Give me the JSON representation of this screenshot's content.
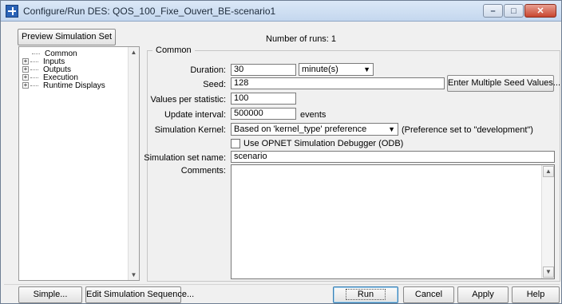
{
  "window": {
    "title": "Configure/Run DES: QOS_100_Fixe_Ouvert_BE-scenario1"
  },
  "top": {
    "preview_label": "Preview Simulation Set",
    "runs_text": "Number of runs: 1"
  },
  "tree": {
    "items": [
      {
        "label": "Common",
        "expandable": false
      },
      {
        "label": "Inputs",
        "expandable": true
      },
      {
        "label": "Outputs",
        "expandable": true
      },
      {
        "label": "Execution",
        "expandable": true
      },
      {
        "label": "Runtime Displays",
        "expandable": true
      }
    ]
  },
  "common": {
    "legend": "Common",
    "duration_label": "Duration:",
    "duration_value": "30",
    "duration_unit": "minute(s)",
    "seed_label": "Seed:",
    "seed_value": "128",
    "seed_button": "Enter Multiple Seed Values...",
    "values_label": "Values per statistic:",
    "values_value": "100",
    "update_label": "Update interval:",
    "update_value": "500000",
    "update_unit": "events",
    "kernel_label": "Simulation Kernel:",
    "kernel_value": "Based on 'kernel_type' preference",
    "kernel_note": "(Preference set to \"development\")",
    "debugger_label": "Use OPNET Simulation Debugger (ODB)",
    "setname_label": "Simulation set name:",
    "setname_value": "scenario",
    "comments_label": "Comments:"
  },
  "bottom": {
    "simple": "Simple...",
    "edit_sequence": "Edit Simulation Sequence...",
    "run": "Run",
    "cancel": "Cancel",
    "apply": "Apply",
    "help": "Help"
  }
}
